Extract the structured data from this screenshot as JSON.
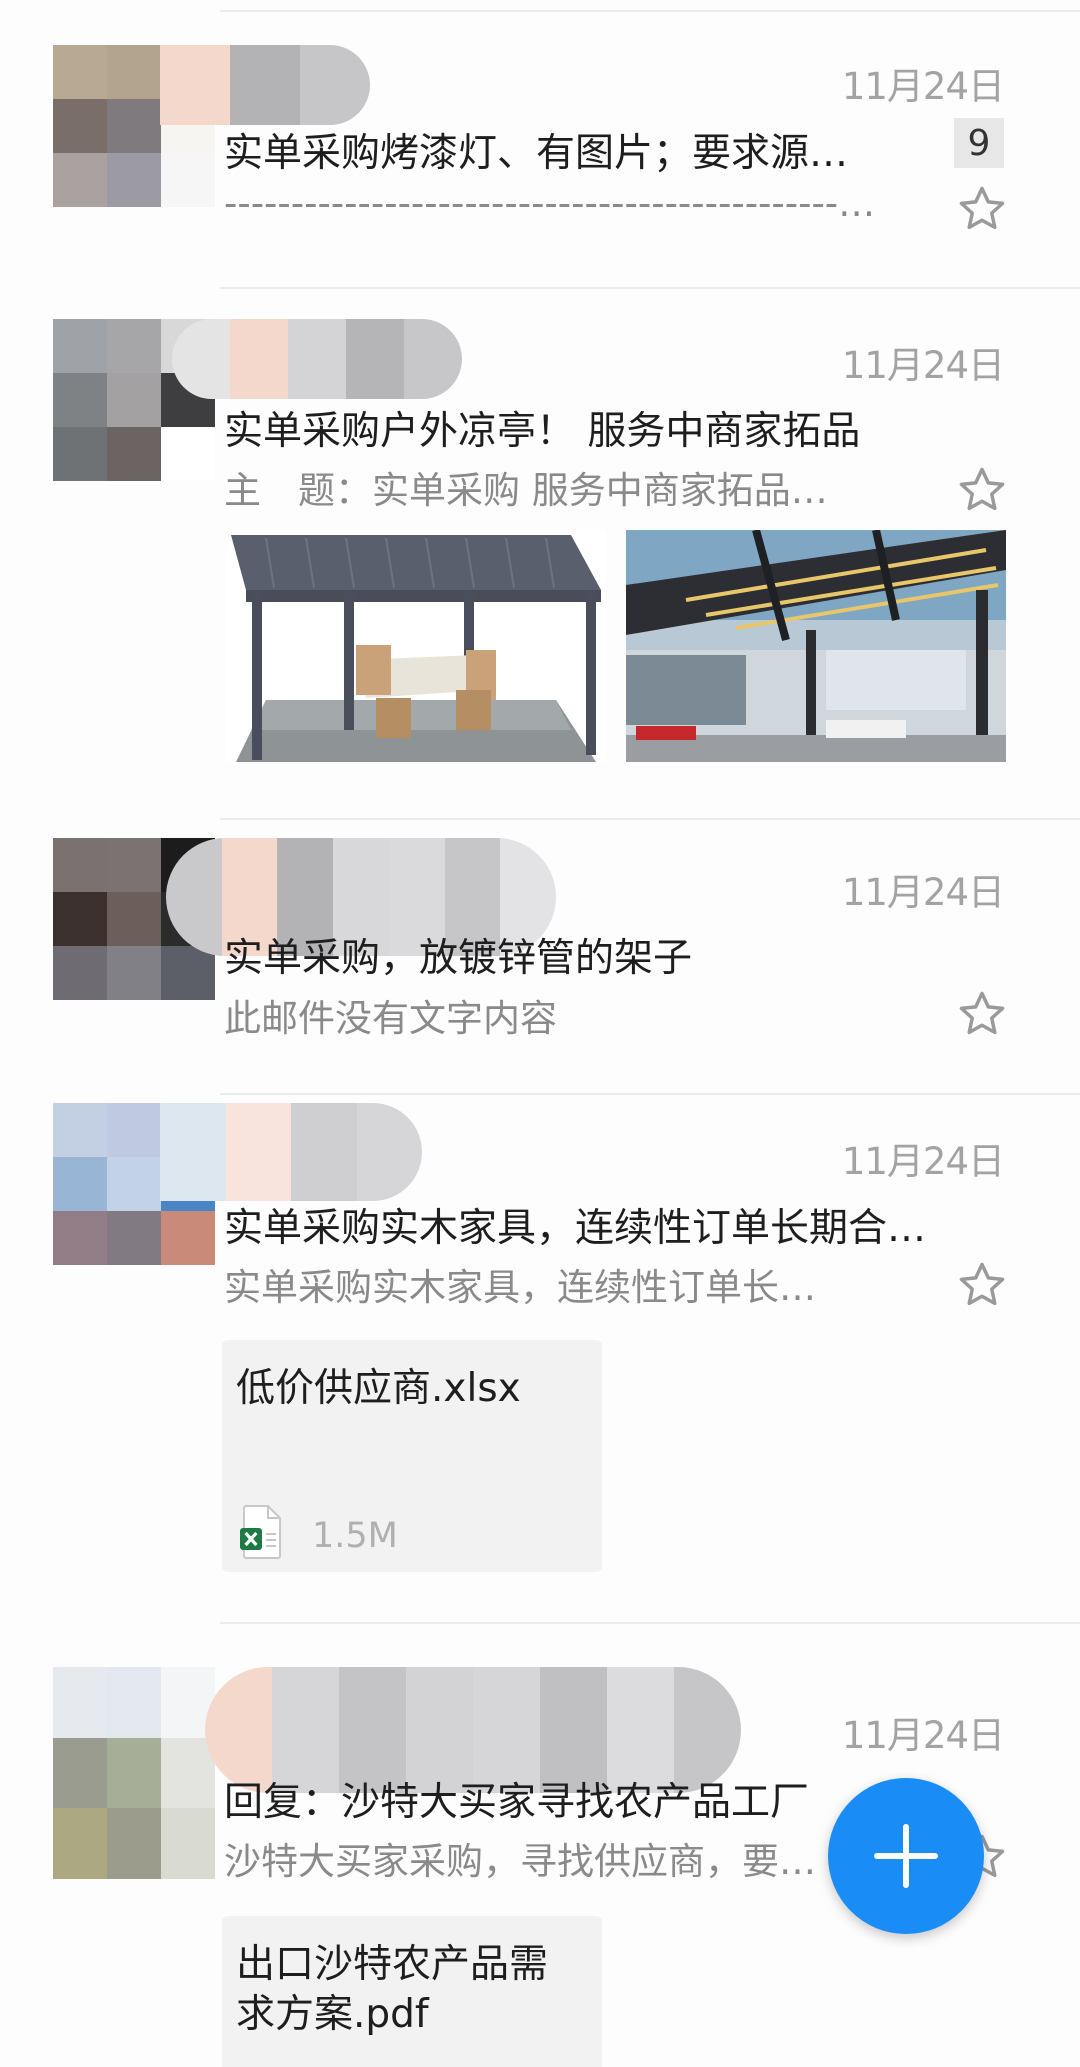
{
  "emails": [
    {
      "date": "11月24日",
      "subject": "实单采购烤漆灯、有图片；要求源…",
      "preview": "----------------------------------------------…",
      "thread_count": "9",
      "star_icon": "star-outline-icon"
    },
    {
      "date": "11月24日",
      "subject": "实单采购户外凉亭！ 服务中商家拓品",
      "preview": "主　题：实单采购 服务中商家拓品…",
      "star_icon": "star-outline-icon",
      "images": [
        "pergola-product-image",
        "pergola-outdoor-image"
      ]
    },
    {
      "date": "11月24日",
      "subject": "实单采购，放镀锌管的架子",
      "preview": "此邮件没有文字内容",
      "star_icon": "star-outline-icon"
    },
    {
      "date": "11月24日",
      "subject": "实单采购实木家具，连续性订单长期合…",
      "preview": "实单采购实木家具，连续性订单长…",
      "star_icon": "star-outline-icon",
      "attachment": {
        "name": "低价供应商.xlsx",
        "size": "1.5M",
        "icon": "excel-file-icon"
      }
    },
    {
      "date": "11月24日",
      "subject": "回复：沙特大买家寻找农产品工厂",
      "preview": "沙特大买家采购，寻找供应商，要求…",
      "star_icon": "star-outline-icon",
      "attachment": {
        "name": "出口沙特农产品需求方案.pdf"
      }
    }
  ],
  "fab": {
    "icon": "plus-icon"
  },
  "colors": {
    "accent": "#1a8cf5",
    "date": "#a3a3a3",
    "preview": "#8a8a8a"
  }
}
